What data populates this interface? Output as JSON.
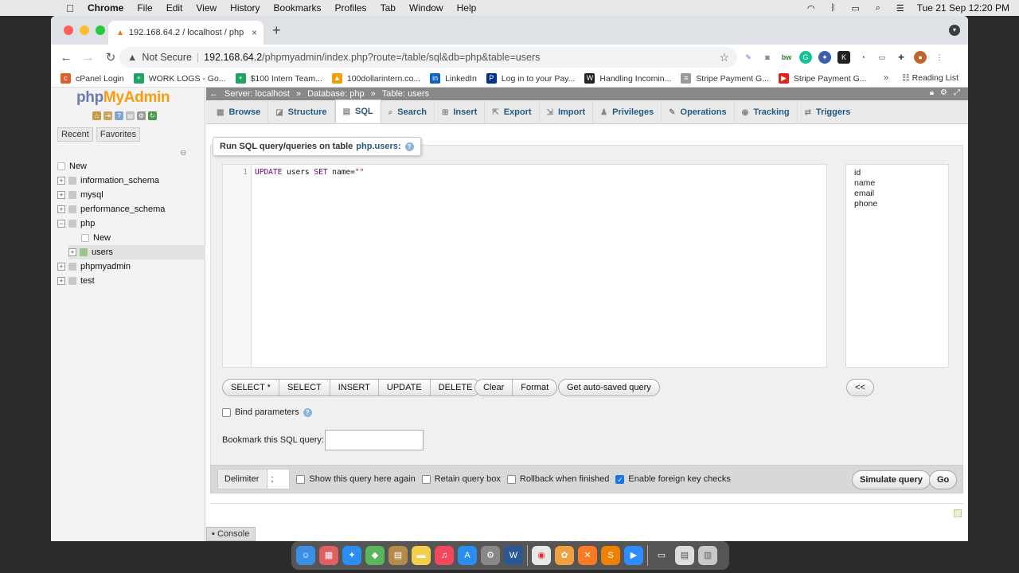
{
  "mac_menu": {
    "app": "Chrome",
    "items": [
      "File",
      "Edit",
      "View",
      "History",
      "Bookmarks",
      "Profiles",
      "Tab",
      "Window",
      "Help"
    ],
    "datetime": "Tue 21 Sep  12:20 PM"
  },
  "browser": {
    "tab_title": "192.168.64.2 / localhost / php",
    "security": "Not Secure",
    "url_host": "192.168.64.2",
    "url_path": "/phpmyadmin/index.php?route=/table/sql&db=php&table=users",
    "bookmarks": [
      {
        "label": "cPanel Login",
        "color": "#e0602b"
      },
      {
        "label": "WORK LOGS - Go...",
        "color": "#1fa463"
      },
      {
        "label": "$100 Intern Team...",
        "color": "#1fa463"
      },
      {
        "label": "100dollarintern.co...",
        "color": "#f0a000"
      },
      {
        "label": "LinkedIn",
        "color": "#0a66c2"
      },
      {
        "label": "Log in to your Pay...",
        "color": "#003087"
      },
      {
        "label": "Handling Incomin...",
        "color": "#222222"
      },
      {
        "label": "Stripe Payment G...",
        "color": "#9a9a9a"
      },
      {
        "label": "Stripe Payment G...",
        "color": "#e62117"
      }
    ],
    "bookmarks_more": "»",
    "reading_list": "Reading List"
  },
  "navigation": {
    "logo_php": "php",
    "logo_myadmin": "MyAdmin",
    "tabs": [
      "Recent",
      "Favorites"
    ],
    "tree": [
      {
        "label": "New",
        "expander": ""
      },
      {
        "label": "information_schema",
        "expander": "+"
      },
      {
        "label": "mysql",
        "expander": "+"
      },
      {
        "label": "performance_schema",
        "expander": "+"
      },
      {
        "label": "php",
        "expander": "−"
      },
      {
        "label": "New",
        "expander": ""
      },
      {
        "label": "users",
        "expander": "+"
      },
      {
        "label": "phpmyadmin",
        "expander": "+"
      },
      {
        "label": "test",
        "expander": "+"
      }
    ]
  },
  "breadcrumb": {
    "server": "Server: localhost",
    "database": "Database: php",
    "table": "Table: users"
  },
  "menu_tabs": [
    "Browse",
    "Structure",
    "SQL",
    "Search",
    "Insert",
    "Export",
    "Import",
    "Privileges",
    "Operations",
    "Tracking",
    "Triggers"
  ],
  "active_tab": "SQL",
  "sql_panel": {
    "legend": "Run SQL query/queries on table",
    "legend_table": "php.users:",
    "line_number": "1",
    "code_kw1": "UPDATE",
    "code_mid": " users ",
    "code_kw2": "SET",
    "code_field": " name=",
    "code_str": "\"\"",
    "columns": [
      "id",
      "name",
      "email",
      "phone"
    ],
    "buttons_group1": [
      "SELECT *",
      "SELECT",
      "INSERT",
      "UPDATE",
      "DELETE"
    ],
    "buttons_group2": [
      "Clear",
      "Format"
    ],
    "auto_saved": "Get auto-saved query",
    "collapse": "<<",
    "bind_params": "Bind parameters",
    "bookmark_label": "Bookmark this SQL query:"
  },
  "bottom": {
    "delimiter_label": "Delimiter",
    "delimiter_value": ";",
    "options": [
      {
        "label": "Show this query here again",
        "checked": false
      },
      {
        "label": "Retain query box",
        "checked": false
      },
      {
        "label": "Rollback when finished",
        "checked": false
      },
      {
        "label": "Enable foreign key checks",
        "checked": true
      }
    ],
    "simulate": "Simulate query",
    "go": "Go"
  },
  "console": "Console"
}
